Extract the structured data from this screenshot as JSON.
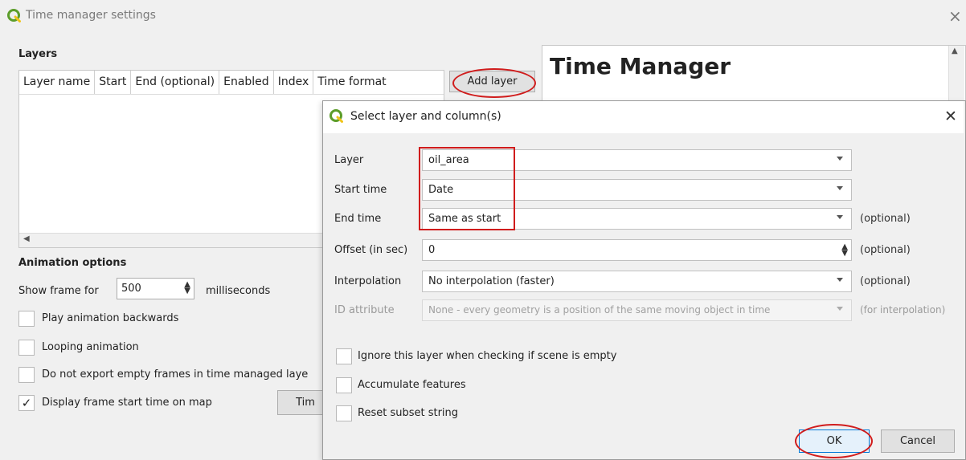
{
  "main_window": {
    "title": "Time manager settings",
    "layers_label": "Layers",
    "columns": [
      "Layer name",
      "Start",
      "End (optional)",
      "Enabled",
      "Index",
      "Time format"
    ],
    "add_layer_label": "Add layer",
    "info_heading": "Time Manager",
    "animation_label": "Animation options",
    "show_frame_label": "Show frame for",
    "frame_value": "500",
    "frame_unit": "milliseconds",
    "checkboxes": [
      {
        "label": "Play animation backwards",
        "checked": false
      },
      {
        "label": "Looping animation",
        "checked": false
      },
      {
        "label": "Do not export empty frames in time managed laye",
        "checked": false
      },
      {
        "label": "Display frame start time on map",
        "checked": true
      }
    ],
    "tim_button_label": "Tim"
  },
  "dialog": {
    "title": "Select layer and column(s)",
    "rows": {
      "layer": {
        "label": "Layer",
        "value": "oil_area"
      },
      "start_time": {
        "label": "Start time",
        "value": "Date"
      },
      "end_time": {
        "label": "End time",
        "value": "Same as start",
        "hint": "(optional)"
      },
      "offset": {
        "label": "Offset (in sec)",
        "value": "0",
        "hint": "(optional)"
      },
      "interpolation": {
        "label": "Interpolation",
        "value": "No interpolation (faster)",
        "hint": "(optional)"
      },
      "id_attribute": {
        "label": "ID attribute",
        "value": "None - every geometry is a position of the same moving object in time",
        "hint": "(for interpolation)"
      }
    },
    "checkboxes": [
      {
        "label": "Ignore this layer when checking if scene is empty",
        "checked": false
      },
      {
        "label": "Accumulate features",
        "checked": false
      },
      {
        "label": "Reset subset string",
        "checked": false
      }
    ],
    "ok_label": "OK",
    "cancel_label": "Cancel"
  },
  "colors": {
    "qgis_green": "#5c9d2a",
    "annotation_red": "#d01c1c"
  }
}
